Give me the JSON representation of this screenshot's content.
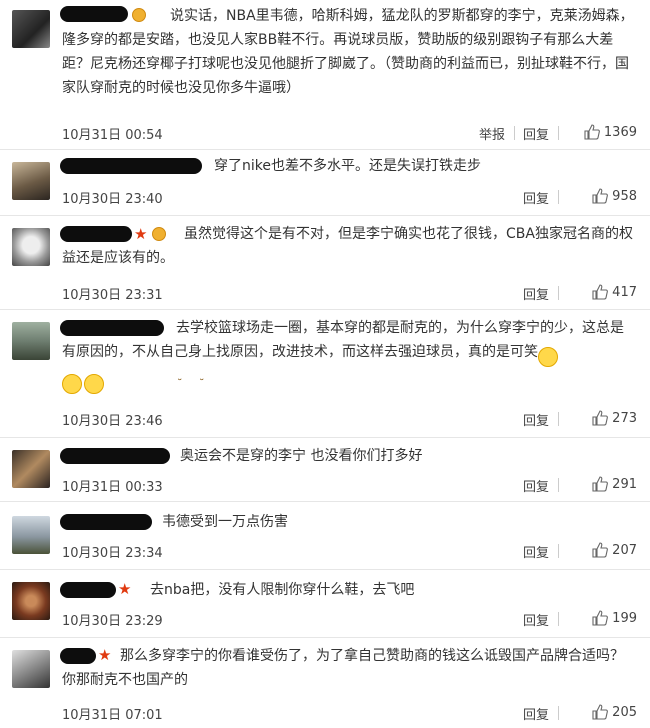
{
  "comments": [
    {
      "text": "说实话，NBA里韦德，哈斯科姆，猛龙队的罗斯都穿的李宁，克莱汤姆森，隆多穿的都是安踏，也没见人家BB鞋不行。再说球员版，赞助版的级别跟钩子有那么大差距？尼克杨还穿椰子打球呢也没见他腿折了脚崴了。（赞助商的利益而已，别扯球鞋不行，国家队穿耐克的时候也没见你多牛逼哦）",
      "time": "10月31日 00:54",
      "report": "举报",
      "reply": "回复",
      "likes": "1369"
    },
    {
      "text": "穿了nike也差不多水平。还是失误打铁走步",
      "time": "10月30日 23:40",
      "reply": "回复",
      "likes": "958"
    },
    {
      "text": "虽然觉得这个是有不对，但是李宁确实也花了很钱，CBA独家冠名商的权益还是应该有的。",
      "time": "10月30日 23:31",
      "reply": "回复",
      "likes": "417"
    },
    {
      "text": "去学校篮球场走一圈，基本穿的都是耐克的，为什么穿李宁的少，这总是有原因的，不从自己身上找原因，改进技术，而这样去强迫球员，真的是可笑",
      "time": "10月30日 23:46",
      "reply": "回复",
      "likes": "273"
    },
    {
      "text": "奥运会不是穿的李宁 也没看你们打多好",
      "time": "10月31日 00:33",
      "reply": "回复",
      "likes": "291"
    },
    {
      "text": "韦德受到一万点伤害",
      "time": "10月30日 23:34",
      "reply": "回复",
      "likes": "207"
    },
    {
      "text": "去nba把，没有人限制你穿什么鞋，去飞吧",
      "time": "10月30日 23:29",
      "reply": "回复",
      "likes": "199"
    },
    {
      "text": "那么多穿李宁的你看谁受伤了，为了拿自己赞助商的钱这么诋毁国产品牌合适吗？你那耐克不也国产的",
      "time": "10月31日 07:01",
      "reply": "回复",
      "likes": "205"
    }
  ],
  "colors": {
    "divider": "#e6e6e6",
    "name_mask": "#0d0d0d",
    "star": "#e03a10",
    "badge": "#f0b030",
    "text": "#333333"
  }
}
